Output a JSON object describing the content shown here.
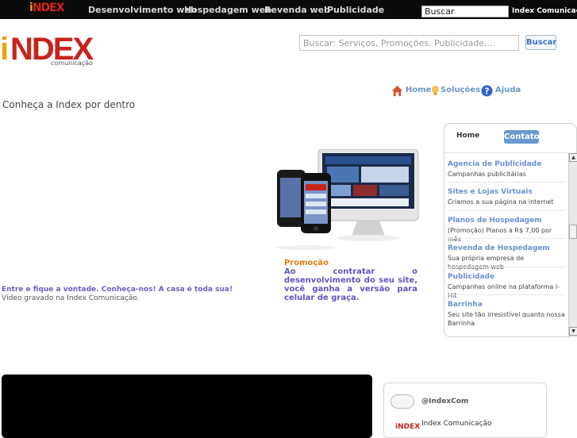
{
  "topbar": {
    "logo_i": "i",
    "logo_ndex": "NDEX",
    "nav": [
      "Desenvolvimento web",
      "Hospedagem web",
      "Revenda web",
      "Publicidade"
    ],
    "search_value": "Buscar",
    "brand": "Index Comunicação"
  },
  "logo": {
    "i": "i",
    "ndex": "NDEX",
    "sub": "comunicação"
  },
  "search": {
    "placeholder": "Buscar: Serviços, Promoções, Publicidade,...",
    "button": "Buscar"
  },
  "quicklinks": {
    "home": "Home",
    "solutions": "Soluções",
    "help": "Ajuda"
  },
  "intro": "Conheça a Index por dentro",
  "video": {
    "caption_title": "Entre e fique a vontade. Conheça-nos! A casa é toda sua!",
    "caption_sub": "Vídeo gravado na Index Comunicação."
  },
  "promo": {
    "title": "Promoção",
    "text": "Ao contratar o desenvolvimento do seu site, você ganha a versão para celular de graça."
  },
  "panel": {
    "tab_home": "Home",
    "tab_contato": "Contato",
    "items": [
      {
        "title": "Agencia de Publicidade",
        "desc": "Campanhas publicitárias"
      },
      {
        "title": "Sites e Lojas Virtuais",
        "desc": "Criamos a sua página na internet"
      },
      {
        "title": "Planos de Hospedagem",
        "desc": "(Promoção) Planos a R$ 7,00 por mês"
      },
      {
        "title": "Revenda de Hospedagem",
        "desc": "Sua própria empresa de hospedagem web"
      },
      {
        "title": "Publicidade",
        "desc": "Campanhas online na plataforma i-Hit"
      },
      {
        "title": "Barrinha",
        "desc": "Seu site tão irresistível quanto nossa Barrinha"
      }
    ]
  },
  "twitter": {
    "handle": "@IndexCom",
    "name": "Index Comunicação",
    "avatar": "iNDEX"
  }
}
